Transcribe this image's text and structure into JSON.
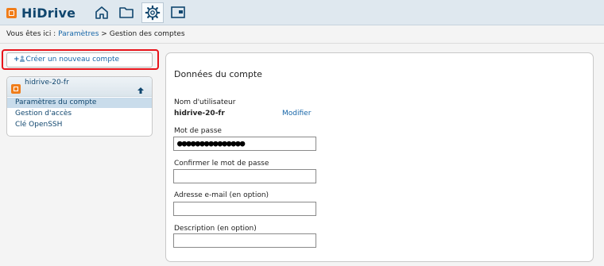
{
  "app": {
    "name": "HiDrive"
  },
  "nav": [
    {
      "id": "home",
      "icon": "home-icon"
    },
    {
      "id": "folder",
      "icon": "folder-icon"
    },
    {
      "id": "settings",
      "icon": "gear-icon",
      "active": true
    },
    {
      "id": "screen",
      "icon": "monitor-icon"
    }
  ],
  "breadcrumb": {
    "prefix": "Vous êtes ici :",
    "link": "Paramètres",
    "separator": ">",
    "current": "Gestion des comptes"
  },
  "sidebar": {
    "create_button": "Créer un nouveau compte",
    "account_name": "hidrive-20-fr",
    "items": [
      {
        "label": "Paramètres du compte",
        "selected": true
      },
      {
        "label": "Gestion d'accès"
      },
      {
        "label": "Clé OpenSSH"
      }
    ]
  },
  "form": {
    "title": "Données du compte",
    "username_label": "Nom d'utilisateur",
    "username_value": "hidrive-20-fr",
    "modify_link": "Modifier",
    "password_label": "Mot de passe",
    "password_value": "●●●●●●●●●●●●●●●",
    "confirm_label": "Confirmer le mot de passe",
    "confirm_value": "",
    "email_label": "Adresse e-mail (en option)",
    "email_value": "",
    "description_label": "Description (en option)",
    "description_value": ""
  },
  "colors": {
    "brand": "#10466e",
    "logo": "#f07d1a",
    "link": "#1565a8",
    "highlight": "#e8141b",
    "selected": "#c9dceb"
  }
}
